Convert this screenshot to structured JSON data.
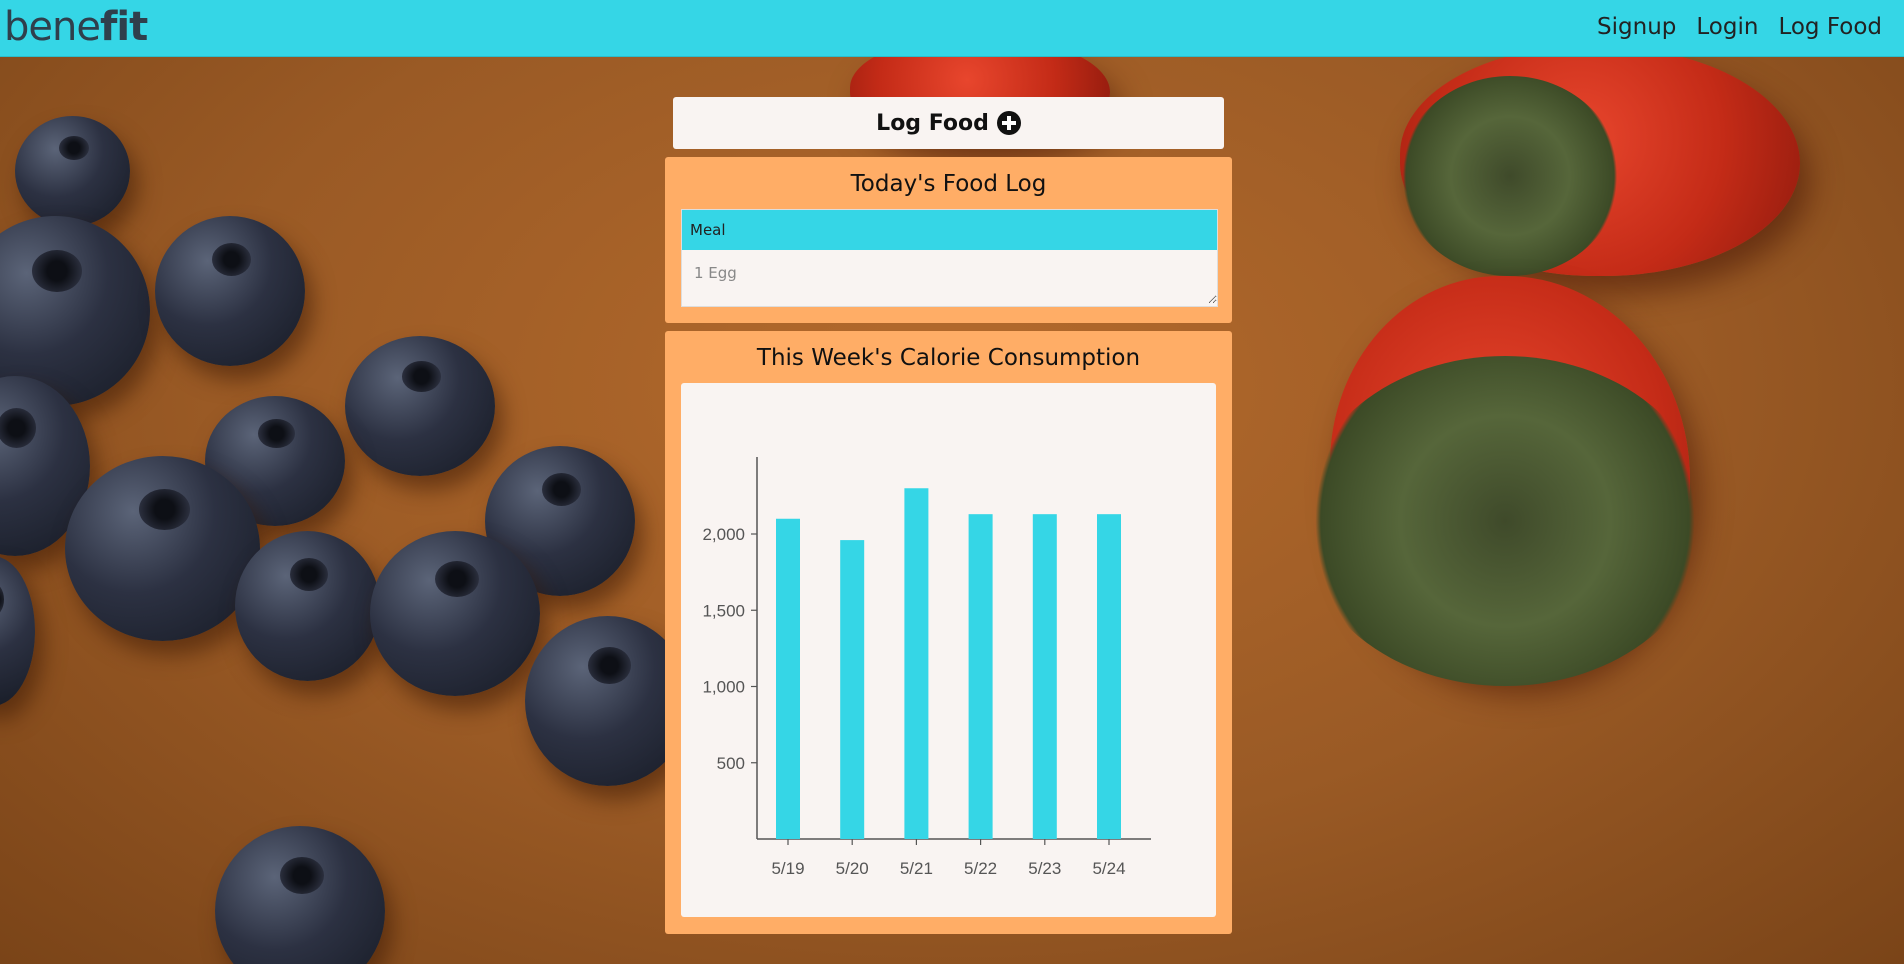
{
  "navbar": {
    "brand_light": "bene",
    "brand_bold": "fit",
    "links": [
      "Signup",
      "Login",
      "Log Food"
    ]
  },
  "log_button": {
    "label": "Log Food",
    "icon": "plus-circle-icon"
  },
  "food_log": {
    "title": "Today's Food Log",
    "header": "Meal",
    "placeholder": "1 Egg"
  },
  "calorie_chart": {
    "title": "This Week's Calorie Consumption"
  },
  "chart_data": {
    "type": "bar",
    "categories": [
      "5/19",
      "5/20",
      "5/21",
      "5/22",
      "5/23",
      "5/24"
    ],
    "values": [
      2100,
      1960,
      2300,
      2130,
      2130,
      2130
    ],
    "y_ticks": [
      "500",
      "1,000",
      "1,500",
      "2,000"
    ],
    "ylim": [
      0,
      2500
    ],
    "bar_color": "#35d6e6",
    "title": "",
    "xlabel": "",
    "ylabel": ""
  },
  "colors": {
    "navbar": "#35d6e6",
    "card": "#ffad66",
    "panel": "#f9f4f2"
  }
}
